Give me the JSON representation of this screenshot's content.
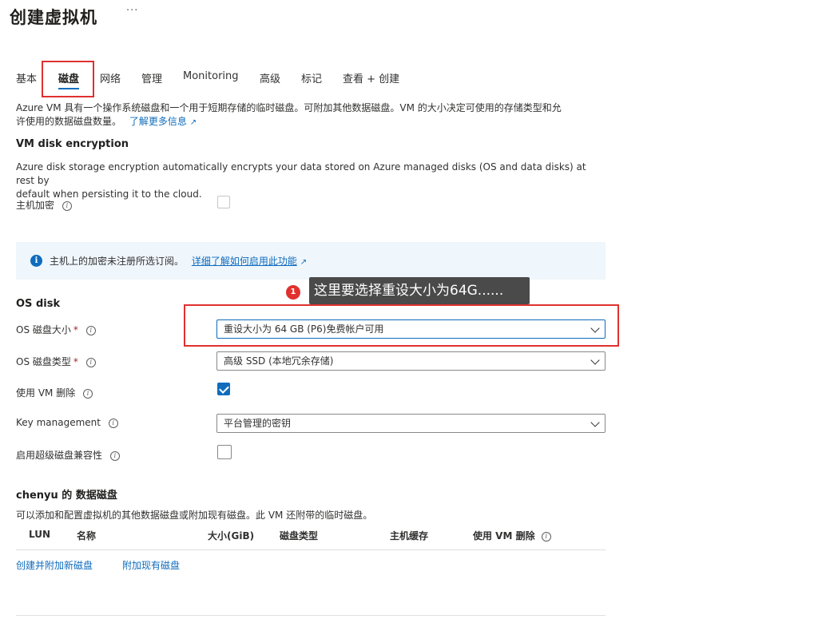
{
  "header": {
    "title": "创建虚拟机",
    "more": "···"
  },
  "tabs": [
    {
      "label": "基本"
    },
    {
      "label": "磁盘"
    },
    {
      "label": "网络"
    },
    {
      "label": "管理"
    },
    {
      "label": "Monitoring"
    },
    {
      "label": "高级"
    },
    {
      "label": "标记"
    },
    {
      "label": "查看 + 创建"
    }
  ],
  "intro": {
    "line1": "Azure VM 具有一个操作系统磁盘和一个用于短期存储的临时磁盘。可附加其他数据磁盘。VM 的大小决定可使用的存储类型和允",
    "line2": "许使用的数据磁盘数量。",
    "link": "了解更多信息"
  },
  "encryption": {
    "heading": "VM disk encryption",
    "desc1": "Azure disk storage encryption automatically encrypts your data stored on Azure managed disks (OS and data disks) at rest by",
    "desc2": "default when persisting it to the cloud.",
    "host_label": "主机加密",
    "host_checked": false
  },
  "banner": {
    "text": "主机上的加密未注册所选订阅。",
    "link": "详细了解如何启用此功能"
  },
  "annotation": {
    "number": "1",
    "text": "这里要选择重设大小为64G......"
  },
  "os_disk": {
    "heading": "OS disk",
    "size_label": "OS 磁盘大小",
    "size_value": "重设大小为 64 GB (P6)免费帐户可用",
    "type_label": "OS 磁盘类型",
    "type_value": "高级 SSD (本地冗余存储)",
    "delete_label": "使用 VM 删除",
    "delete_checked": true,
    "key_label": "Key management",
    "key_value": "平台管理的密钥",
    "ultra_label": "启用超级磁盘兼容性",
    "ultra_checked": false,
    "required_mark": "*"
  },
  "data_disks": {
    "heading": "chenyu 的 数据磁盘",
    "desc": "可以添加和配置虚拟机的其他数据磁盘或附加现有磁盘。此 VM 还附带的临时磁盘。",
    "columns": [
      "LUN",
      "名称",
      "大小(GiB)",
      "磁盘类型",
      "主机缓存",
      "使用 VM 删除"
    ],
    "create_link": "创建并附加新磁盘",
    "attach_link": "附加现有磁盘"
  },
  "colors": {
    "accent": "#0f6cbd",
    "annotation": "#e0312f",
    "banner_bg": "#eff6fc"
  }
}
